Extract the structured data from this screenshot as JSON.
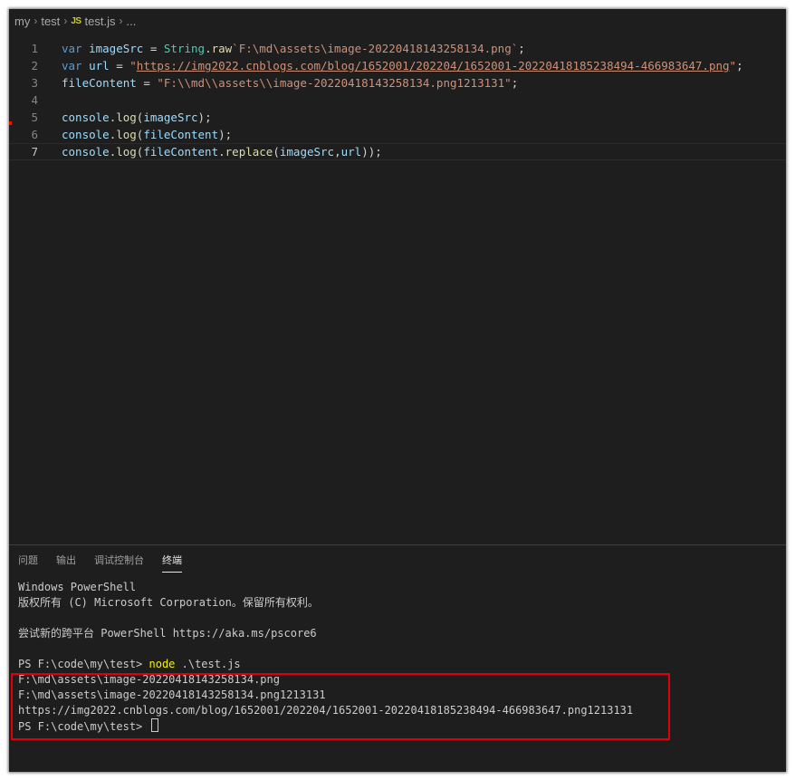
{
  "breadcrumb": {
    "items": [
      "my",
      "test"
    ],
    "file_badge": "JS",
    "file_name": "test.js",
    "ellipsis": "..."
  },
  "editor": {
    "lines": [
      {
        "number": "1",
        "tokens": [
          {
            "t": "var",
            "c": "kw"
          },
          {
            "t": " ",
            "c": "punc"
          },
          {
            "t": "imageSrc",
            "c": "var"
          },
          {
            "t": " = ",
            "c": "punc"
          },
          {
            "t": "String",
            "c": "cls"
          },
          {
            "t": ".",
            "c": "punc"
          },
          {
            "t": "raw",
            "c": "fn"
          },
          {
            "t": "`F:\\md\\assets\\image-20220418143258134.png`",
            "c": "str"
          },
          {
            "t": ";",
            "c": "punc"
          }
        ]
      },
      {
        "number": "2",
        "tokens": [
          {
            "t": "var",
            "c": "kw"
          },
          {
            "t": " ",
            "c": "punc"
          },
          {
            "t": "url",
            "c": "var"
          },
          {
            "t": " = ",
            "c": "punc"
          },
          {
            "t": "\"",
            "c": "str"
          },
          {
            "t": "https://img2022.cnblogs.com/blog/1652001/202204/1652001-20220418185238494-466983647.png",
            "c": "str url"
          },
          {
            "t": "\"",
            "c": "str"
          },
          {
            "t": ";",
            "c": "punc"
          }
        ]
      },
      {
        "number": "3",
        "tokens": [
          {
            "t": "fileContent",
            "c": "var"
          },
          {
            "t": " = ",
            "c": "punc"
          },
          {
            "t": "\"F:\\\\md\\\\assets\\\\image-20220418143258134.png1213131\"",
            "c": "str"
          },
          {
            "t": ";",
            "c": "punc"
          }
        ]
      },
      {
        "number": "4",
        "tokens": []
      },
      {
        "number": "5",
        "tokens": [
          {
            "t": "console",
            "c": "var"
          },
          {
            "t": ".",
            "c": "punc"
          },
          {
            "t": "log",
            "c": "fn"
          },
          {
            "t": "(",
            "c": "punc"
          },
          {
            "t": "imageSrc",
            "c": "var"
          },
          {
            "t": ");",
            "c": "punc"
          }
        ]
      },
      {
        "number": "6",
        "tokens": [
          {
            "t": "console",
            "c": "var"
          },
          {
            "t": ".",
            "c": "punc"
          },
          {
            "t": "log",
            "c": "fn"
          },
          {
            "t": "(",
            "c": "punc"
          },
          {
            "t": "fileContent",
            "c": "var"
          },
          {
            "t": ");",
            "c": "punc"
          }
        ]
      },
      {
        "number": "7",
        "current": true,
        "tokens": [
          {
            "t": "console",
            "c": "var"
          },
          {
            "t": ".",
            "c": "punc"
          },
          {
            "t": "log",
            "c": "fn"
          },
          {
            "t": "(",
            "c": "punc"
          },
          {
            "t": "fileContent",
            "c": "var"
          },
          {
            "t": ".",
            "c": "punc"
          },
          {
            "t": "replace",
            "c": "fn"
          },
          {
            "t": "(",
            "c": "punc"
          },
          {
            "t": "imageSrc",
            "c": "var"
          },
          {
            "t": ",",
            "c": "punc"
          },
          {
            "t": "url",
            "c": "var"
          },
          {
            "t": "));",
            "c": "punc"
          }
        ]
      }
    ]
  },
  "panel": {
    "tabs": [
      {
        "label": "问题",
        "active": false
      },
      {
        "label": "输出",
        "active": false
      },
      {
        "label": "调试控制台",
        "active": false
      },
      {
        "label": "终端",
        "active": true
      }
    ]
  },
  "terminal": {
    "lines": [
      {
        "text": "Windows PowerShell"
      },
      {
        "text": "版权所有 (C) Microsoft Corporation。保留所有权利。"
      },
      {
        "text": ""
      },
      {
        "text": "尝试新的跨平台 PowerShell https://aka.ms/pscore6"
      },
      {
        "text": ""
      },
      {
        "prompt": "PS F:\\code\\my\\test> ",
        "command": "node",
        "args": " .\\test.js"
      },
      {
        "text": "F:\\md\\assets\\image-20220418143258134.png"
      },
      {
        "text": "F:\\md\\assets\\image-20220418143258134.png1213131"
      },
      {
        "text": "https://img2022.cnblogs.com/blog/1652001/202204/1652001-20220418185238494-466983647.png1213131"
      },
      {
        "prompt": "PS F:\\code\\my\\test> ",
        "cursor": true
      }
    ]
  },
  "colors": {
    "background": "#1e1e1e",
    "keyword": "#569cd6",
    "variable": "#9cdcfe",
    "class": "#4ec9b0",
    "function": "#dcdcaa",
    "string": "#ce9178",
    "terminal_command": "#f2f200",
    "highlight_box": "#e0000b"
  }
}
